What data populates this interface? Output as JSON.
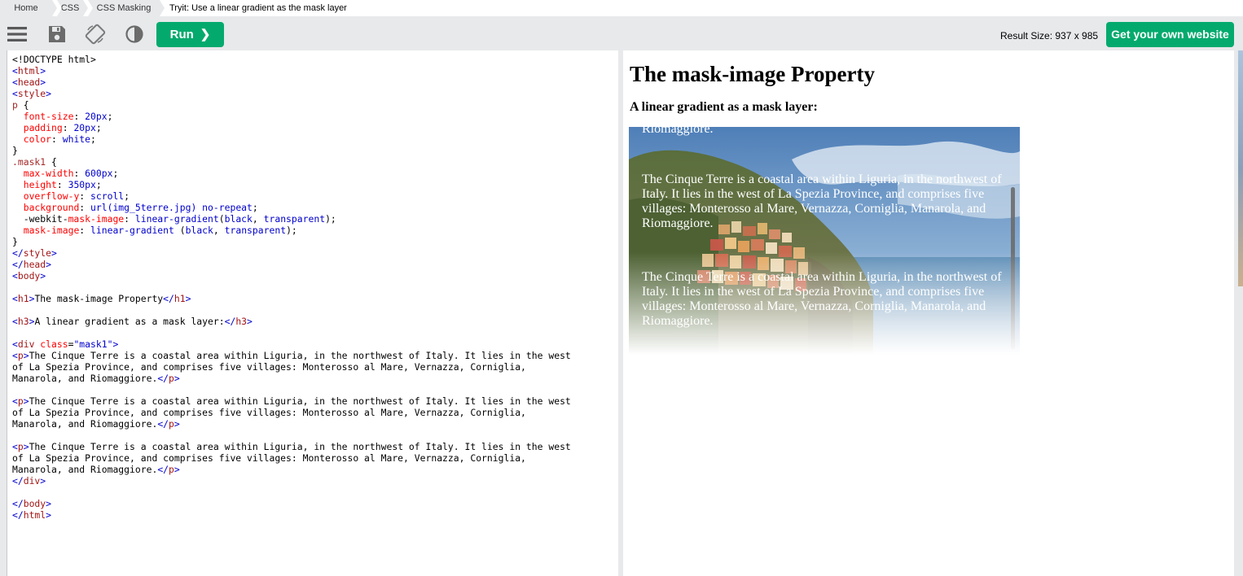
{
  "breadcrumb": {
    "home": "Home",
    "css": "CSS",
    "masking": "CSS Masking",
    "current": "Tryit: Use a linear gradient as the mask layer"
  },
  "toolbar": {
    "icons": [
      "menu-icon",
      "save-icon",
      "rotate-icon",
      "contrast-icon"
    ],
    "run_label": "Run",
    "run_chevron": "❯",
    "result_size": "Result Size: 937 x 985",
    "own_website_label": "Get your own website"
  },
  "code_lines": [
    [
      [
        "t",
        "<!DOCTYPE html>"
      ]
    ],
    [
      [
        "a",
        "<"
      ],
      [
        "tag",
        "html"
      ],
      [
        "a",
        ">"
      ]
    ],
    [
      [
        "a",
        "<"
      ],
      [
        "tag",
        "head"
      ],
      [
        "a",
        ">"
      ]
    ],
    [
      [
        "a",
        "<"
      ],
      [
        "tag",
        "style"
      ],
      [
        "a",
        ">"
      ]
    ],
    [
      [
        "sel",
        "p"
      ],
      [
        "t",
        " {"
      ]
    ],
    [
      [
        "t",
        "  "
      ],
      [
        "prop",
        "font-size"
      ],
      [
        "t",
        ": "
      ],
      [
        "val",
        "20px"
      ],
      [
        "t",
        ";"
      ]
    ],
    [
      [
        "t",
        "  "
      ],
      [
        "prop",
        "padding"
      ],
      [
        "t",
        ": "
      ],
      [
        "val",
        "20px"
      ],
      [
        "t",
        ";"
      ]
    ],
    [
      [
        "t",
        "  "
      ],
      [
        "prop",
        "color"
      ],
      [
        "t",
        ": "
      ],
      [
        "val",
        "white"
      ],
      [
        "t",
        ";"
      ]
    ],
    [
      [
        "t",
        "}"
      ]
    ],
    [
      [
        "sel",
        ".mask1"
      ],
      [
        "t",
        " {"
      ]
    ],
    [
      [
        "t",
        "  "
      ],
      [
        "prop",
        "max-width"
      ],
      [
        "t",
        ": "
      ],
      [
        "val",
        "600px"
      ],
      [
        "t",
        ";"
      ]
    ],
    [
      [
        "t",
        "  "
      ],
      [
        "prop",
        "height"
      ],
      [
        "t",
        ": "
      ],
      [
        "val",
        "350px"
      ],
      [
        "t",
        ";"
      ]
    ],
    [
      [
        "t",
        "  "
      ],
      [
        "prop",
        "overflow-y"
      ],
      [
        "t",
        ": "
      ],
      [
        "val",
        "scroll"
      ],
      [
        "t",
        ";"
      ]
    ],
    [
      [
        "t",
        "  "
      ],
      [
        "prop",
        "background"
      ],
      [
        "t",
        ": "
      ],
      [
        "val",
        "url(img_5terre.jpg) no-repeat"
      ],
      [
        "t",
        ";"
      ]
    ],
    [
      [
        "t",
        "  -webkit-"
      ],
      [
        "prop",
        "mask-image"
      ],
      [
        "t",
        ": "
      ],
      [
        "val",
        "linear-gradient"
      ],
      [
        "t",
        "("
      ],
      [
        "val",
        "black"
      ],
      [
        "t",
        ", "
      ],
      [
        "val",
        "transparent"
      ],
      [
        "t",
        ");"
      ]
    ],
    [
      [
        "t",
        "  "
      ],
      [
        "prop",
        "mask-image"
      ],
      [
        "t",
        ": "
      ],
      [
        "val",
        "linear-gradient"
      ],
      [
        "t",
        " ("
      ],
      [
        "val",
        "black"
      ],
      [
        "t",
        ", "
      ],
      [
        "val",
        "transparent"
      ],
      [
        "t",
        ");"
      ]
    ],
    [
      [
        "t",
        "}"
      ]
    ],
    [
      [
        "a",
        "</"
      ],
      [
        "tag",
        "style"
      ],
      [
        "a",
        ">"
      ]
    ],
    [
      [
        "a",
        "</"
      ],
      [
        "tag",
        "head"
      ],
      [
        "a",
        ">"
      ]
    ],
    [
      [
        "a",
        "<"
      ],
      [
        "tag",
        "body"
      ],
      [
        "a",
        ">"
      ]
    ],
    [],
    [
      [
        "a",
        "<"
      ],
      [
        "tag",
        "h1"
      ],
      [
        "a",
        ">"
      ],
      [
        "t",
        "The mask-image Property"
      ],
      [
        "a",
        "</"
      ],
      [
        "tag",
        "h1"
      ],
      [
        "a",
        ">"
      ]
    ],
    [],
    [
      [
        "a",
        "<"
      ],
      [
        "tag",
        "h3"
      ],
      [
        "a",
        ">"
      ],
      [
        "t",
        "A linear gradient as a mask layer:"
      ],
      [
        "a",
        "</"
      ],
      [
        "tag",
        "h3"
      ],
      [
        "a",
        ">"
      ]
    ],
    [],
    [
      [
        "a",
        "<"
      ],
      [
        "tag",
        "div"
      ],
      [
        "t",
        " "
      ],
      [
        "attr",
        "class"
      ],
      [
        "t",
        "="
      ],
      [
        "str",
        "\"mask1\""
      ],
      [
        "a",
        ">"
      ]
    ],
    [
      [
        "a",
        "<"
      ],
      [
        "tag",
        "p"
      ],
      [
        "a",
        ">"
      ],
      [
        "t",
        "The Cinque Terre is a coastal area within Liguria, in the northwest of Italy. It lies in the west"
      ]
    ],
    [
      [
        "t",
        "of La Spezia Province, and comprises five villages: Monterosso al Mare, Vernazza, Corniglia,"
      ]
    ],
    [
      [
        "t",
        "Manarola, and Riomaggiore."
      ],
      [
        "a",
        "</"
      ],
      [
        "tag",
        "p"
      ],
      [
        "a",
        ">"
      ]
    ],
    [],
    [
      [
        "a",
        "<"
      ],
      [
        "tag",
        "p"
      ],
      [
        "a",
        ">"
      ],
      [
        "t",
        "The Cinque Terre is a coastal area within Liguria, in the northwest of Italy. It lies in the west"
      ]
    ],
    [
      [
        "t",
        "of La Spezia Province, and comprises five villages: Monterosso al Mare, Vernazza, Corniglia,"
      ]
    ],
    [
      [
        "t",
        "Manarola, and Riomaggiore."
      ],
      [
        "a",
        "</"
      ],
      [
        "tag",
        "p"
      ],
      [
        "a",
        ">"
      ]
    ],
    [],
    [
      [
        "a",
        "<"
      ],
      [
        "tag",
        "p"
      ],
      [
        "a",
        ">"
      ],
      [
        "t",
        "The Cinque Terre is a coastal area within Liguria, in the northwest of Italy. It lies in the west"
      ]
    ],
    [
      [
        "t",
        "of La Spezia Province, and comprises five villages: Monterosso al Mare, Vernazza, Corniglia,"
      ]
    ],
    [
      [
        "t",
        "Manarola, and Riomaggiore."
      ],
      [
        "a",
        "</"
      ],
      [
        "tag",
        "p"
      ],
      [
        "a",
        ">"
      ]
    ],
    [
      [
        "a",
        "</"
      ],
      [
        "tag",
        "div"
      ],
      [
        "a",
        ">"
      ]
    ],
    [],
    [
      [
        "a",
        "</"
      ],
      [
        "tag",
        "body"
      ],
      [
        "a",
        ">"
      ]
    ],
    [
      [
        "a",
        "</"
      ],
      [
        "tag",
        "html"
      ],
      [
        "a",
        ">"
      ]
    ]
  ],
  "result": {
    "h1": "The mask-image Property",
    "h3": "A linear gradient as a mask layer:",
    "partial_text": "Riomaggiore.",
    "paragraph": "The Cinque Terre is a coastal area within Liguria, in the northwest of Italy. It lies in the west of La Spezia Province, and comprises five villages: Monterosso al Mare, Vernazza, Corniglia, Manarola, and Riomaggiore."
  }
}
